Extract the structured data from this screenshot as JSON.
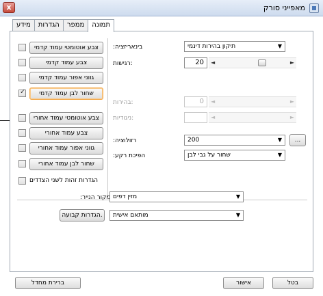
{
  "window": {
    "title": "מאפייני סורק",
    "close_label": "x"
  },
  "tabs": [
    {
      "label": "מידע"
    },
    {
      "label": "הגדרות"
    },
    {
      "label": "ממפר"
    },
    {
      "label": "תמונה"
    }
  ],
  "left_buttons": [
    {
      "label": "צבע אוטומטי עמוד קדמי",
      "checked": false
    },
    {
      "label": "צבע עמוד קדמי",
      "checked": false
    },
    {
      "label": "גווני אפור עמוד קדמי",
      "checked": false
    },
    {
      "label": "שחור לבן עמוד קדמי",
      "checked": true
    },
    {
      "label": "צבע אוטומטי עמוד אחורי",
      "checked": false
    },
    {
      "label": "צבע עמוד אחורי",
      "checked": false
    },
    {
      "label": "גווני אפור עמוד אחורי",
      "checked": false
    },
    {
      "label": "שחור לבן עמוד אחורי",
      "checked": false
    }
  ],
  "settings": {
    "binarization_label": ":בינאריזציה",
    "binarization_value": "תיקון בהירות דינמי",
    "sensitivity_label": "רגישות:",
    "sensitivity_value": "20",
    "brightness_label": "בהירות:",
    "brightness_value": "0",
    "contrast_label": "ניגודיות:",
    "resolution_label": ":רזולוציה",
    "resolution_value": "200",
    "resolution_more": "...",
    "invert_label": ":הפיכת רקע",
    "invert_value": "שחור על גבי לבן"
  },
  "same_settings_label": "הגדרות זהות לשני הצדדים",
  "paper_source_label": ":מקור הנייר",
  "paper_source_value": "מזין דפים",
  "custom_value": "מותאם אישית",
  "fixed_settings_button": "הגדרות קבועה.",
  "footer": {
    "default_button": "ברירת מחדל",
    "ok_button": "אישור",
    "cancel_button": "בטל"
  }
}
